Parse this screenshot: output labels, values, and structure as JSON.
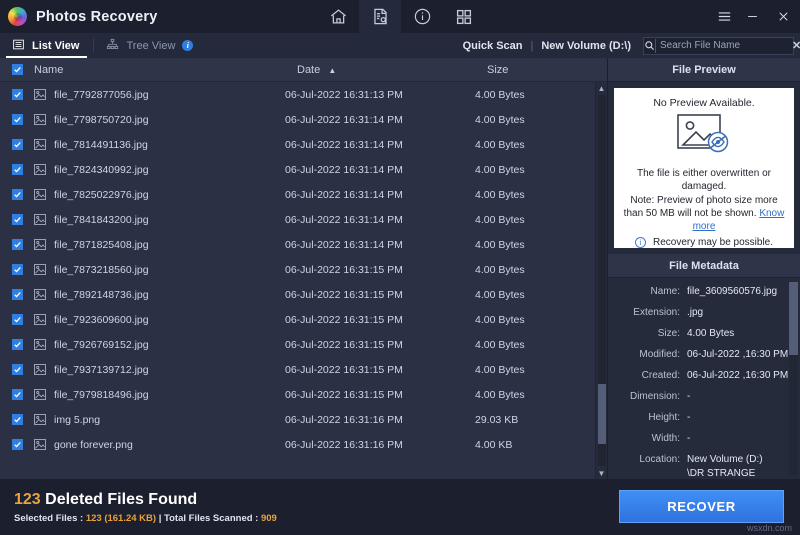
{
  "window": {
    "app_title": "Photos Recovery",
    "logo_icon": "photos-recovery-logo",
    "toolbar_icons": [
      {
        "name": "home-icon",
        "label": "Home"
      },
      {
        "name": "scan-document-icon",
        "label": "Scan"
      },
      {
        "name": "info-icon",
        "label": "Info"
      },
      {
        "name": "grid-icon",
        "label": "Grid"
      }
    ],
    "controls": {
      "menu": "☰",
      "minimize": "−",
      "close": "×"
    }
  },
  "tabs": [
    {
      "label": "List View",
      "icon": "list-view-icon",
      "active": true,
      "badge": ""
    },
    {
      "label": "Tree View",
      "icon": "tree-view-icon",
      "active": false,
      "badge": "i"
    }
  ],
  "scan_info": {
    "mode": "Quick Scan",
    "separator": "|",
    "volume": "New Volume (D:\\)"
  },
  "search": {
    "placeholder": "Search File Name",
    "value": "",
    "icon": "search-icon",
    "clear_icon": "close-icon"
  },
  "table": {
    "columns": {
      "name": "Name",
      "date": "Date",
      "size": "Size"
    },
    "sort_column": "Date",
    "sort_direction": "ascending",
    "sort_arrow": "▲",
    "header_checkbox_checked": true,
    "rows": [
      {
        "name": "file_7792877056.jpg",
        "date": "06-Jul-2022 16:31:13 PM",
        "size": "4.00 Bytes",
        "checked": true
      },
      {
        "name": "file_7798750720.jpg",
        "date": "06-Jul-2022 16:31:14 PM",
        "size": "4.00 Bytes",
        "checked": true
      },
      {
        "name": "file_7814491136.jpg",
        "date": "06-Jul-2022 16:31:14 PM",
        "size": "4.00 Bytes",
        "checked": true
      },
      {
        "name": "file_7824340992.jpg",
        "date": "06-Jul-2022 16:31:14 PM",
        "size": "4.00 Bytes",
        "checked": true
      },
      {
        "name": "file_7825022976.jpg",
        "date": "06-Jul-2022 16:31:14 PM",
        "size": "4.00 Bytes",
        "checked": true
      },
      {
        "name": "file_7841843200.jpg",
        "date": "06-Jul-2022 16:31:14 PM",
        "size": "4.00 Bytes",
        "checked": true
      },
      {
        "name": "file_7871825408.jpg",
        "date": "06-Jul-2022 16:31:14 PM",
        "size": "4.00 Bytes",
        "checked": true
      },
      {
        "name": "file_7873218560.jpg",
        "date": "06-Jul-2022 16:31:15 PM",
        "size": "4.00 Bytes",
        "checked": true
      },
      {
        "name": "file_7892148736.jpg",
        "date": "06-Jul-2022 16:31:15 PM",
        "size": "4.00 Bytes",
        "checked": true
      },
      {
        "name": "file_7923609600.jpg",
        "date": "06-Jul-2022 16:31:15 PM",
        "size": "4.00 Bytes",
        "checked": true
      },
      {
        "name": "file_7926769152.jpg",
        "date": "06-Jul-2022 16:31:15 PM",
        "size": "4.00 Bytes",
        "checked": true
      },
      {
        "name": "file_7937139712.jpg",
        "date": "06-Jul-2022 16:31:15 PM",
        "size": "4.00 Bytes",
        "checked": true
      },
      {
        "name": "file_7979818496.jpg",
        "date": "06-Jul-2022 16:31:15 PM",
        "size": "4.00 Bytes",
        "checked": true
      },
      {
        "name": "img 5.png",
        "date": "06-Jul-2022 16:31:16 PM",
        "size": "29.03 KB",
        "checked": true
      },
      {
        "name": "gone forever.png",
        "date": "06-Jul-2022 16:31:16 PM",
        "size": "4.00 KB",
        "checked": true
      }
    ]
  },
  "preview": {
    "header": "File Preview",
    "no_preview": "No Preview Available.",
    "image_icon": "image-no-preview-icon",
    "message_line1": "The file is either overwritten or",
    "message_line2": "damaged.",
    "note": "Note: Preview of photo size more than 50 MB will not be shown.",
    "know_more": "Know more",
    "recovery_note": "Recovery may be possible.",
    "info_icon": "info-icon"
  },
  "metadata": {
    "header": "File Metadata",
    "fields": [
      {
        "label": "Name:",
        "value": "file_3609560576.jpg"
      },
      {
        "label": "Extension:",
        "value": ".jpg"
      },
      {
        "label": "Size:",
        "value": "4.00 Bytes"
      },
      {
        "label": "Modified:",
        "value": "06-Jul-2022 ,16:30 PM"
      },
      {
        "label": "Created:",
        "value": "06-Jul-2022 ,16:30 PM"
      },
      {
        "label": "Dimension:",
        "value": "-"
      },
      {
        "label": "Height:",
        "value": "-"
      },
      {
        "label": "Width:",
        "value": "-"
      },
      {
        "label": "Location:",
        "value": "New Volume (D:)"
      },
      {
        "label": "",
        "value": "\\DR STRANGE"
      }
    ]
  },
  "footer": {
    "found_count": "123",
    "found_label": "Deleted Files Found",
    "selected_prefix": "Selected Files :",
    "selected_count": "123",
    "selected_size": "(161.24 KB)",
    "divider": "|",
    "scanned_prefix": "Total Files Scanned :",
    "scanned_count": "909",
    "recover_label": "RECOVER"
  },
  "watermark": "wsxdn.com",
  "colors": {
    "accent_blue": "#2f7fe0",
    "amber": "#e8a33a",
    "titlebar_bg": "#1b1f2e",
    "panel_bg": "#262b3c",
    "list_bg": "#2b3044",
    "header_bg": "#2f3549"
  }
}
